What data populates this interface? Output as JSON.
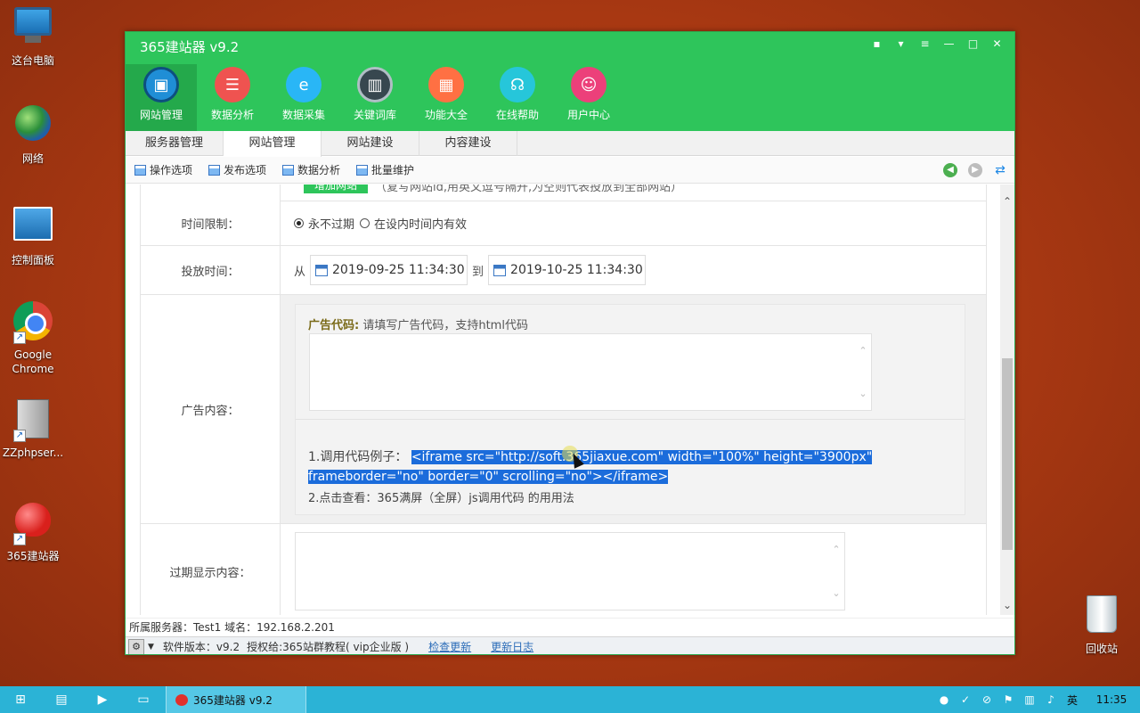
{
  "desktop": {
    "icons": [
      {
        "label": "这台电脑",
        "icon": "computer-icon"
      },
      {
        "label": "网络",
        "icon": "network-icon"
      },
      {
        "label": "控制面板",
        "icon": "control-panel-icon"
      },
      {
        "label": "Google Chrome",
        "icon": "chrome-icon"
      },
      {
        "label": "ZZphpser...",
        "icon": "server-icon"
      },
      {
        "label": "365建站器",
        "icon": "apple-icon"
      },
      {
        "label": "回收站",
        "icon": "recycle-bin-icon"
      }
    ]
  },
  "window": {
    "title": "365建站器 v9.2",
    "toolbar": [
      {
        "label": "网站管理",
        "color": "#1f8ed6"
      },
      {
        "label": "数据分析",
        "color": "#ef5350"
      },
      {
        "label": "数据采集",
        "color": "#29b6f6"
      },
      {
        "label": "关键词库",
        "color": "#37474f"
      },
      {
        "label": "功能大全",
        "color": "#ff7043"
      },
      {
        "label": "在线帮助",
        "color": "#26c6da"
      },
      {
        "label": "用户中心",
        "color": "#ec407a"
      }
    ],
    "tabs": [
      "服务器管理",
      "网站管理",
      "网站建设",
      "内容建设"
    ],
    "subtoolbar": [
      "操作选项",
      "发布选项",
      "数据分析",
      "批量维护"
    ]
  },
  "form": {
    "top_button": "增加网站",
    "top_hint": "（复写网站id,用英文逗号隔开,为空则代表投放到全部网站）",
    "time_limit": {
      "label": "时间限制：",
      "option1": "永不过期",
      "option2": "在设内时间内有效"
    },
    "schedule": {
      "label": "投放时间：",
      "from": "从",
      "to": "到",
      "start": "2019-09-25 11:34:30",
      "end": "2019-10-25 11:34:30"
    },
    "ad_content": {
      "label": "广告内容：",
      "code_label": "广告代码:",
      "code_hint": "请填写广告代码，支持html代码",
      "example_prefix": "1.调用代码例子：",
      "example_code": "<iframe src=\"http://soft.365jiaxue.com\" width=\"100%\" height=\"3900px\" frameborder=\"no\" border=\"0\" scrolling=\"no\"></iframe>",
      "example2": "2.点击查看：365满屏（全屏）js调用代码 的用用法"
    },
    "expire_label": "过期显示内容："
  },
  "status": {
    "server_line": "所属服务器：Test1 域名：192.168.2.201",
    "version": "软件版本：v9.2",
    "license": "授权给:365站群教程( vip企业版 )",
    "check_update": "检查更新",
    "changelog": "更新日志"
  },
  "taskbar": {
    "app_label": "365建站器 v9.2",
    "ime": "英",
    "time": "11:35"
  }
}
